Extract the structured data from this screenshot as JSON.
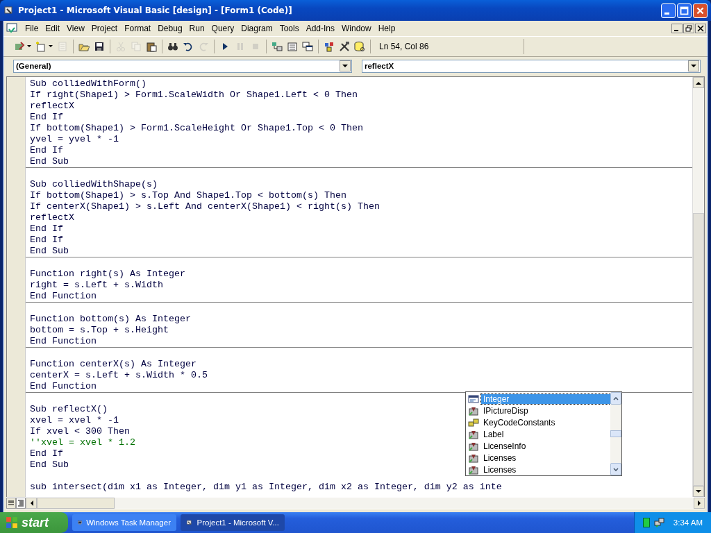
{
  "window": {
    "title": "Project1 - Microsoft Visual Basic [design] - [Form1 (Code)]"
  },
  "menu": [
    "File",
    "Edit",
    "View",
    "Project",
    "Format",
    "Debug",
    "Run",
    "Query",
    "Diagram",
    "Tools",
    "Add-Ins",
    "Window",
    "Help"
  ],
  "toolbar": [
    {
      "kind": "add-project",
      "disabled": false
    },
    {
      "kind": "add-form",
      "disabled": false
    },
    {
      "kind": "menu-editor",
      "disabled": true
    },
    {
      "kind": "open",
      "disabled": false
    },
    {
      "kind": "save",
      "disabled": false
    },
    {
      "kind": "cut",
      "disabled": true
    },
    {
      "kind": "copy",
      "disabled": true
    },
    {
      "kind": "paste",
      "disabled": false
    },
    {
      "kind": "find",
      "disabled": false
    },
    {
      "kind": "undo",
      "disabled": false
    },
    {
      "kind": "redo",
      "disabled": true
    },
    {
      "kind": "start",
      "disabled": false
    },
    {
      "kind": "break",
      "disabled": true
    },
    {
      "kind": "end",
      "disabled": true
    },
    {
      "kind": "project-explorer",
      "disabled": false
    },
    {
      "kind": "properties",
      "disabled": false
    },
    {
      "kind": "form-layout",
      "disabled": false
    },
    {
      "kind": "object-browser",
      "disabled": false
    },
    {
      "kind": "toolbox",
      "disabled": false
    },
    {
      "kind": "data-view",
      "disabled": false
    }
  ],
  "position": "Ln 54, Col 86",
  "object_combo": "(General)",
  "procedure_combo": "reflectX",
  "procedures": [
    {
      "divided": false,
      "lines": [
        {
          "kind": "code",
          "text": "Sub colliedWithForm()"
        },
        {
          "kind": "code",
          "text": "If right(Shape1) > Form1.ScaleWidth Or Shape1.Left < 0 Then"
        },
        {
          "kind": "code",
          "text": "reflectX"
        },
        {
          "kind": "code",
          "text": "End If"
        },
        {
          "kind": "code",
          "text": "If bottom(Shape1) > Form1.ScaleHeight Or Shape1.Top < 0 Then"
        },
        {
          "kind": "code",
          "text": "yvel = yvel * -1"
        },
        {
          "kind": "code",
          "text": "End If"
        },
        {
          "kind": "code",
          "text": "End Sub"
        }
      ]
    },
    {
      "divided": true,
      "lines": [
        {
          "kind": "code",
          "text": "Sub colliedWithShape(s)"
        },
        {
          "kind": "code",
          "text": "If bottom(Shape1) > s.Top And Shape1.Top < bottom(s) Then"
        },
        {
          "kind": "code",
          "text": "If centerX(Shape1) > s.Left And centerX(Shape1) < right(s) Then"
        },
        {
          "kind": "code",
          "text": "reflectX"
        },
        {
          "kind": "code",
          "text": "End If"
        },
        {
          "kind": "code",
          "text": "End If"
        },
        {
          "kind": "code",
          "text": "End Sub"
        }
      ]
    },
    {
      "divided": true,
      "lines": [
        {
          "kind": "code",
          "text": "Function right(s) As Integer"
        },
        {
          "kind": "code",
          "text": "right = s.Left + s.Width"
        },
        {
          "kind": "code",
          "text": "End Function"
        }
      ]
    },
    {
      "divided": true,
      "lines": [
        {
          "kind": "code",
          "text": "Function bottom(s) As Integer"
        },
        {
          "kind": "code",
          "text": "bottom = s.Top + s.Height"
        },
        {
          "kind": "code",
          "text": "End Function"
        }
      ]
    },
    {
      "divided": true,
      "lines": [
        {
          "kind": "code",
          "text": "Function centerX(s) As Integer"
        },
        {
          "kind": "code",
          "text": "centerX = s.Left + s.Width * 0.5"
        },
        {
          "kind": "code",
          "text": "End Function"
        }
      ]
    },
    {
      "divided": true,
      "lines": [
        {
          "kind": "code",
          "text": "Sub reflectX()"
        },
        {
          "kind": "code",
          "text": "xvel = xvel * -1"
        },
        {
          "kind": "code",
          "text": "If xvel < 300 Then"
        },
        {
          "kind": "comment",
          "text": "''xvel = xvel * 1.2"
        },
        {
          "kind": "code",
          "text": "End If"
        },
        {
          "kind": "code",
          "text": "End Sub"
        }
      ]
    },
    {
      "divided": false,
      "lines": [
        {
          "kind": "code",
          "text": "sub intersect(dim x1 as Integer, dim y1 as Integer, dim x2 as Integer, dim y2 as inte"
        }
      ]
    }
  ],
  "completion": [
    {
      "label": "Integer",
      "kind": "type",
      "selected": true
    },
    {
      "label": "IPictureDisp",
      "kind": "class",
      "selected": false
    },
    {
      "label": "KeyCodeConstants",
      "kind": "enum",
      "selected": false
    },
    {
      "label": "Label",
      "kind": "class",
      "selected": false
    },
    {
      "label": "LicenseInfo",
      "kind": "class",
      "selected": false
    },
    {
      "label": "Licenses",
      "kind": "class",
      "selected": false
    },
    {
      "label": "Licenses",
      "kind": "class",
      "selected": false
    }
  ],
  "taskbar": {
    "start": "start",
    "tasks": [
      {
        "label": "Windows Task Manager",
        "kind": "taskmgr",
        "selected": false
      },
      {
        "label": "Project1 - Microsoft V...",
        "kind": "vb",
        "selected": true
      }
    ],
    "clock": "3:34 AM"
  }
}
